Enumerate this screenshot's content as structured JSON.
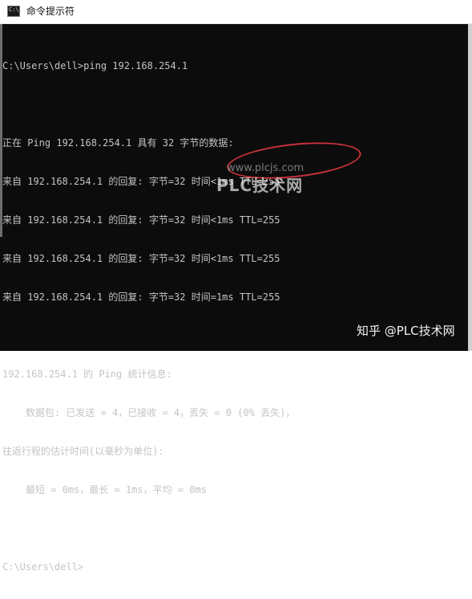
{
  "window": {
    "title": "命令提示符",
    "icon": "cmd-icon",
    "icon_text": "C:\\."
  },
  "console": {
    "lines": [
      "C:\\Users\\dell>ping 192.168.254.1",
      "",
      "正在 Ping 192.168.254.1 具有 32 字节的数据:",
      "来自 192.168.254.1 的回复: 字节=32 时间<1ms TTL=255",
      "来自 192.168.254.1 的回复: 字节=32 时间<1ms TTL=255",
      "来自 192.168.254.1 的回复: 字节=32 时间<1ms TTL=255",
      "来自 192.168.254.1 的回复: 字节=32 时间=1ms TTL=255",
      "",
      "192.168.254.1 的 Ping 统计信息:",
      "    数据包: 已发送 = 4，已接收 = 4，丢失 = 0 (0% 丢失)，",
      "往返行程的估计时间(以毫秒为单位):",
      "    最短 = 0ms，最长 = 1ms，平均 = 0ms",
      "",
      "C:\\Users\\dell>"
    ]
  },
  "annotation": {
    "highlight_color": "#c8323a"
  },
  "watermarks": {
    "url": "www.plcjs.com",
    "logo": "PLC技术网",
    "corner": "知乎 @PLC技术网"
  }
}
